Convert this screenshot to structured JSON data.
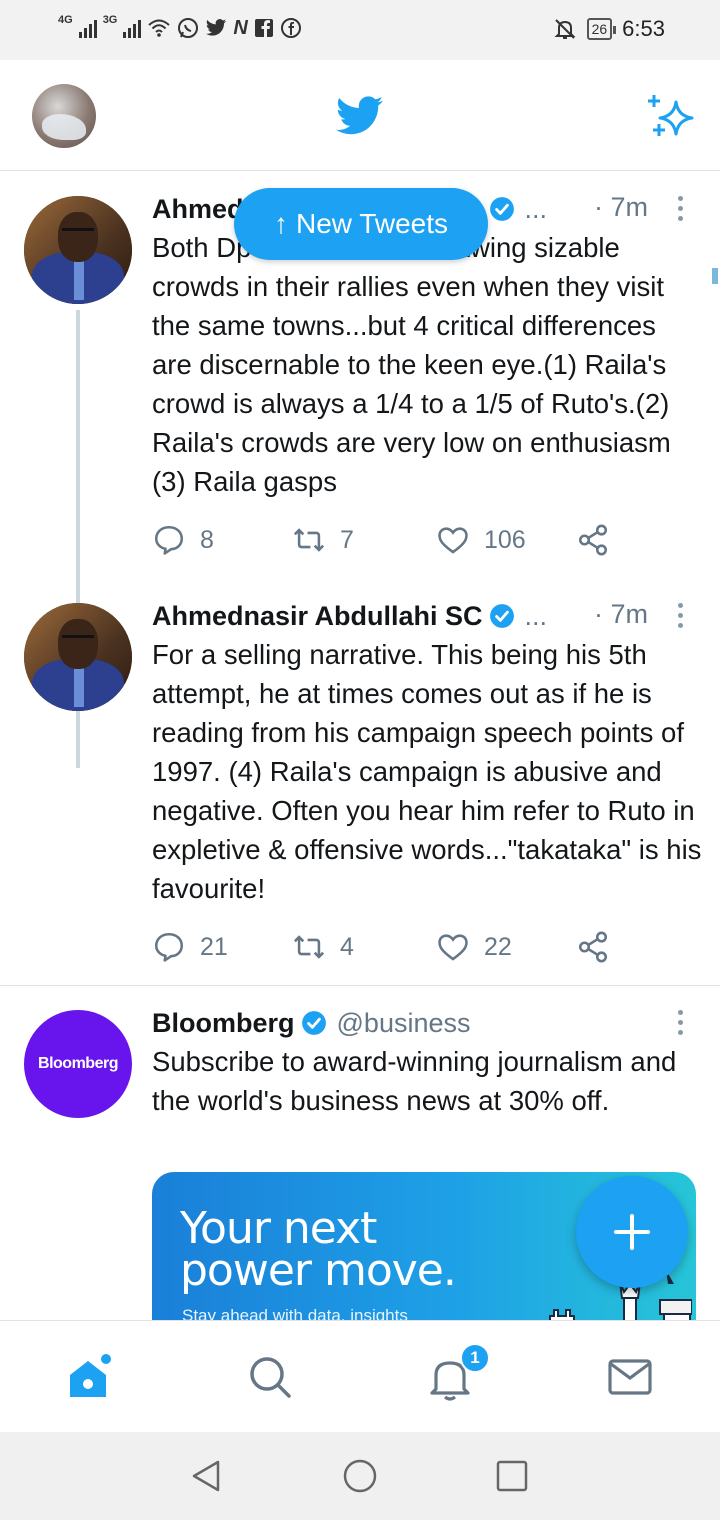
{
  "status_bar": {
    "network_1": "4G",
    "network_2": "3G",
    "battery": "26",
    "time": "6:53"
  },
  "header": {
    "profile_avatar_icon": "user-avatar",
    "logo_icon": "twitter-bird-icon",
    "sparkle_icon": "sparkle-icon"
  },
  "new_tweets_pill": {
    "arrow": "↑",
    "label": "New Tweets"
  },
  "tweets": [
    {
      "name": "Ahmednasir Abdullahi SC",
      "ellipsis": "...",
      "time": "· 7m",
      "text": "Both Dp and Raila are drawing sizable crowds in their rallies even when they visit the same towns...but 4 critical differences are discernable to the keen eye.(1) Raila's crowd is always a 1/4 to a 1/5 of Ruto's.(2) Raila's crowds are very low on enthusiasm (3) Raila gasps",
      "replies": "8",
      "retweets": "7",
      "likes": "106"
    },
    {
      "name": "Ahmednasir Abdullahi SC",
      "ellipsis": "...",
      "time": "· 7m",
      "text": "For a selling narrative. This being his 5th attempt, he at times comes out as if he is reading from his campaign speech points of 1997. (4) Raila's campaign is abusive and negative. Often you hear him refer to Ruto in expletive & offensive words...\"takataka\" is his favourite!",
      "replies": "21",
      "retweets": "4",
      "likes": "22"
    },
    {
      "name": "Bloomberg",
      "handle": "@business",
      "avatar_text": "Bloomberg",
      "text": "Subscribe to award-winning journalism and the world's business news at 30% off.",
      "promo_headline": "Your next power move.",
      "promo_sub": "Stay ahead with data, insights"
    }
  ],
  "bottom_nav": {
    "items": [
      "home-icon",
      "search-icon",
      "notifications-icon",
      "messages-icon"
    ],
    "notification_count": "1"
  },
  "colors": {
    "accent": "#1da1f2",
    "bloomberg": "#6715ec",
    "text": "#14171a",
    "muted": "#657786"
  }
}
